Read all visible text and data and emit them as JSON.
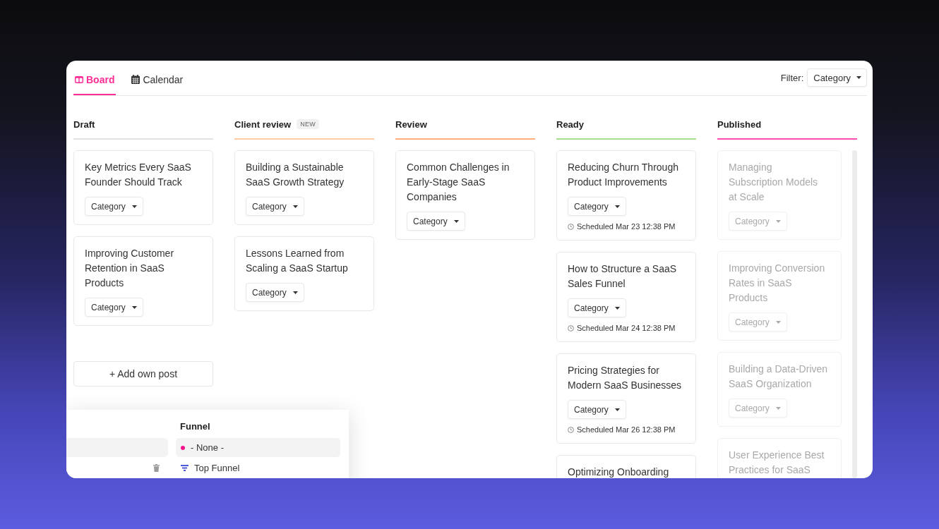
{
  "tabs": [
    {
      "label": "Board",
      "selected": true
    },
    {
      "label": "Calendar",
      "selected": false
    }
  ],
  "filter": {
    "label": "Filter:",
    "value": "Category"
  },
  "columns": [
    {
      "title": "Draft",
      "color": "#e2e2e2",
      "dimmed": false,
      "scrollable": false,
      "cards": [
        {
          "title": "Key Metrics Every SaaS Founder Should Track",
          "category": "Category"
        },
        {
          "title": "Improving Customer Retention in SaaS Products",
          "category": "Category"
        }
      ],
      "add_button": "+ Add own post"
    },
    {
      "title": "Client review",
      "badge": "NEW",
      "color": "#ffc9a3",
      "dimmed": false,
      "scrollable": false,
      "cards": [
        {
          "title": "Building a Sustainable SaaS Growth Strategy",
          "category": "Category"
        },
        {
          "title": "Lessons Learned from Scaling a SaaS Startup",
          "category": "Category"
        }
      ]
    },
    {
      "title": "Review",
      "color": "#ffb07a",
      "dimmed": false,
      "scrollable": false,
      "cards": [
        {
          "title": "Common Challenges in Early-Stage SaaS Companies",
          "category": "Category"
        }
      ]
    },
    {
      "title": "Ready",
      "color": "#a8de8c",
      "dimmed": false,
      "scrollable": false,
      "cards": [
        {
          "title": "Reducing Churn Through Product Improvements",
          "category": "Category",
          "scheduled": "Scheduled Mar 23 12:38 PM"
        },
        {
          "title": "How to Structure a SaaS Sales Funnel",
          "category": "Category",
          "scheduled": "Scheduled Mar 24 12:38 PM"
        },
        {
          "title": "Pricing Strategies for Modern SaaS Businesses",
          "category": "Category",
          "scheduled": "Scheduled Mar 26 12:38 PM"
        },
        {
          "title": "Optimizing Onboarding"
        }
      ]
    },
    {
      "title": "Published",
      "color": "#ff4daf",
      "dimmed": true,
      "scrollable": true,
      "cards": [
        {
          "title": "Managing Subscription Models at Scale",
          "category": "Category"
        },
        {
          "title": "Improving Conversion Rates in SaaS Products",
          "category": "Category"
        },
        {
          "title": "Building a Data-Driven SaaS Organization",
          "category": "Category"
        },
        {
          "title": "User Experience Best Practices for SaaS"
        }
      ]
    }
  ],
  "dropdown": {
    "rows": [
      {
        "selected": true,
        "deletable": false
      },
      {
        "selected": false,
        "deletable": true
      }
    ],
    "heading": "Funnel",
    "options": [
      {
        "label": "- None -",
        "color": "#f5148c",
        "selected": true
      },
      {
        "label": "Top Funnel",
        "color": "#4f5ad8",
        "selected": false
      }
    ]
  }
}
